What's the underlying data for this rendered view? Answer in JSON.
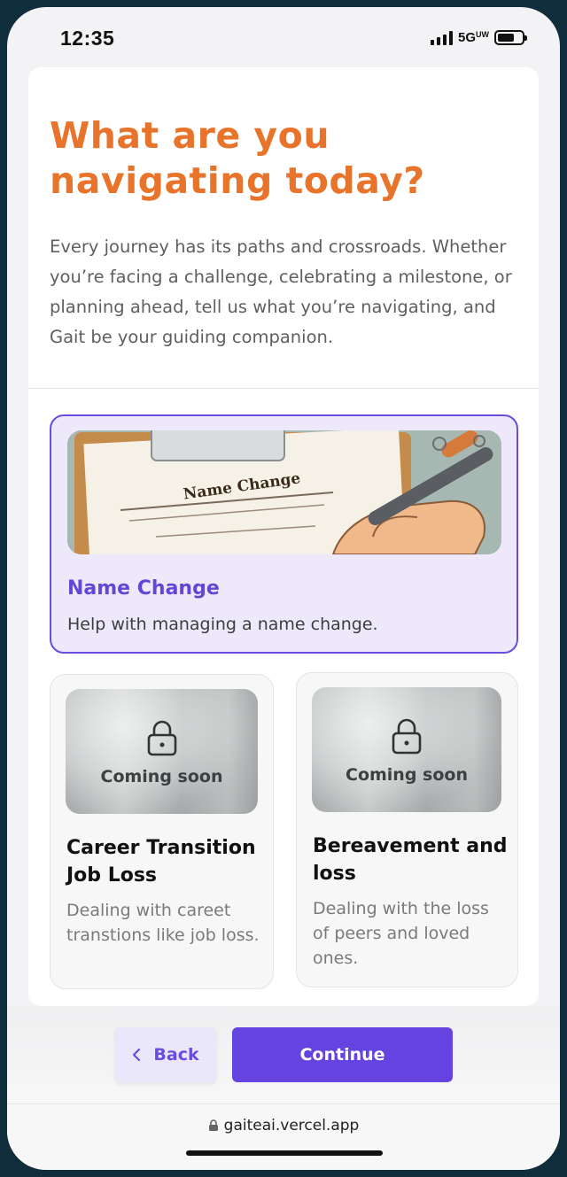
{
  "status": {
    "time": "12:35",
    "network": "5G",
    "network_sub": "UW"
  },
  "page": {
    "title": "What are you navigating today?",
    "description": "Every journey has its paths and crossroads. Whether you’re facing a challenge, celebrating a milestone, or planning ahead, tell us what you’re navigating, and Gait be your guiding companion."
  },
  "options": [
    {
      "title": "Name Change",
      "description": "Help with managing a name change.",
      "selected": true,
      "image_text": "Name Change"
    },
    {
      "title": "Career Transition Job Loss",
      "description": "Dealing with careet transtions like job loss.",
      "badge": "Coming soon"
    },
    {
      "title": "Bereavement and loss",
      "description": "Dealing with the loss of peers and loved ones.",
      "badge": "Coming soon"
    }
  ],
  "footer": {
    "back_label": "Back",
    "continue_label": "Continue"
  },
  "browser": {
    "url": "gaiteai.vercel.app"
  },
  "colors": {
    "accent": "#6443e0",
    "title": "#e8742c",
    "selected_bg": "#ede9fb"
  }
}
